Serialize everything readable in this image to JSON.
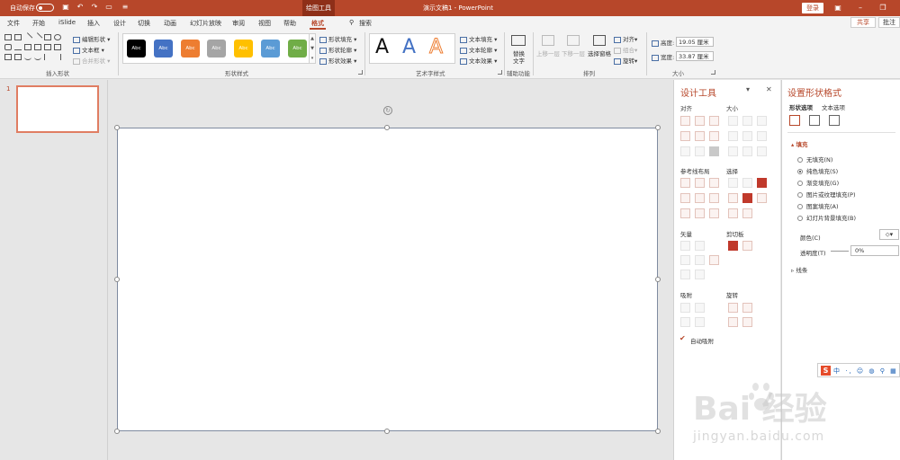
{
  "titlebar": {
    "autosave_label": "自动保存",
    "context_tab": "绘图工具",
    "doc_title": "演示文稿1  -  PowerPoint",
    "login_label": "登录"
  },
  "menu": {
    "items": [
      "文件",
      "开始",
      "iSlide",
      "插入",
      "设计",
      "切换",
      "动画",
      "幻灯片放映",
      "审阅",
      "视图",
      "帮助",
      "格式"
    ],
    "search_label": "搜索",
    "share_label": "共享",
    "comment_label": "批注"
  },
  "ribbon": {
    "insert_shapes": {
      "edit_shape": "编辑形状",
      "text_box": "文本框",
      "merge_shapes": "合并形状",
      "label": "插入形状"
    },
    "shape_styles": {
      "swatch_text": "Abc",
      "swatch_colors": [
        "#000000",
        "#4472c4",
        "#ed7d31",
        "#a5a5a5",
        "#ffc000",
        "#5b9bd5",
        "#70ad47"
      ],
      "fill": "形状填充",
      "outline": "形状轮廓",
      "effects": "形状效果",
      "label": "形状样式"
    },
    "wordart": {
      "glyph": "A",
      "text_fill": "文本填充",
      "text_outline": "文本轮廓",
      "text_effects": "文本效果",
      "label": "艺术字样式"
    },
    "accessibility": {
      "alt_text_1": "替换",
      "alt_text_2": "文字",
      "label": "辅助功能"
    },
    "arrange": {
      "bring_forward": "上移一层",
      "send_backward": "下移一层",
      "selection_pane": "选择窗格",
      "align": "对齐",
      "group": "组合",
      "rotate": "旋转",
      "label": "排列"
    },
    "size": {
      "height_label": "高度:",
      "height_value": "19.05 厘米",
      "width_label": "宽度:",
      "width_value": "33.87 厘米",
      "label": "大小"
    }
  },
  "thumbnails": {
    "slide_number": "1"
  },
  "design_pane": {
    "title": "设计工具",
    "sections": {
      "align": "对齐",
      "size": "大小",
      "guides": "参考线布局",
      "select": "选择",
      "vector": "矢量",
      "clipboard": "剪切板",
      "snap": "吸附",
      "rotate": "旋转"
    },
    "auto_snap": "自动吸附"
  },
  "format_pane": {
    "title": "设置形状格式",
    "tabs": [
      "形状选项",
      "文本选项"
    ],
    "fill_header": "填充",
    "fill_options": [
      "无填充(N)",
      "纯色填充(S)",
      "渐变填充(G)",
      "图片或纹理填充(P)",
      "图案填充(A)",
      "幻灯片背景填充(B)"
    ],
    "selected_fill_index": 1,
    "color_label": "颜色(C)",
    "transparency_label": "透明度(T)",
    "transparency_value": "0%",
    "line_header": "线条"
  },
  "ime": {
    "logo": "S",
    "rest": "中 ·, ☺ ◍ ⚲ ▦ ⚙"
  },
  "watermark": {
    "main": "Bai   经验",
    "sub": "jingyan.baidu.com"
  }
}
